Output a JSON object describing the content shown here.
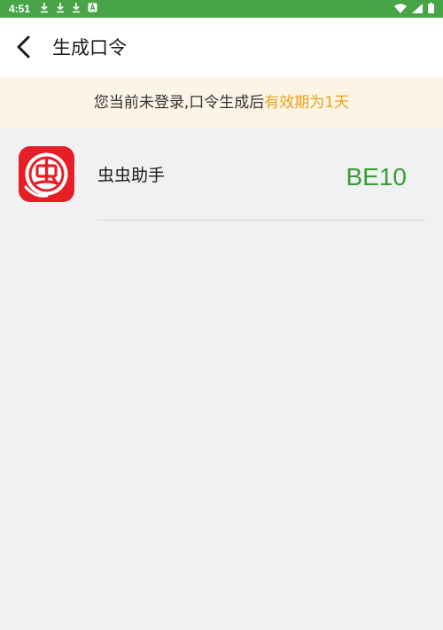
{
  "status_bar": {
    "time": "4:51",
    "notifications": [
      "download-icon",
      "download-icon",
      "download-icon",
      "app-icon"
    ],
    "indicators": [
      "wifi-icon",
      "signal-icon",
      "battery-icon"
    ],
    "color": "#47a447"
  },
  "header": {
    "title": "生成口令",
    "back_icon": "chevron-left-icon"
  },
  "notice": {
    "text_prefix": "您当前未登录,口令生成后",
    "text_highlight": "有效期为1天",
    "highlight_color": "#e8a21c"
  },
  "items": [
    {
      "app_name": "虫虫助手",
      "code": "BE10",
      "icon": "chongchong-logo-icon",
      "code_color": "#3a9d37"
    }
  ]
}
